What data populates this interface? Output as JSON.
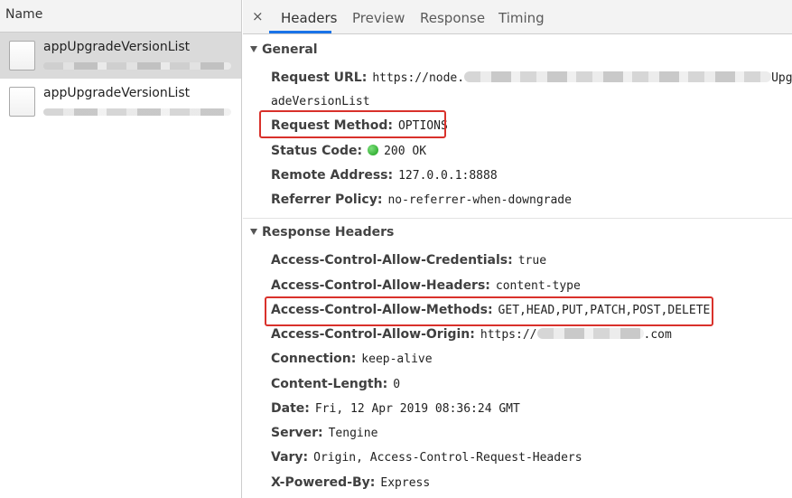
{
  "left_panel": {
    "header": "Name",
    "requests": [
      {
        "name": "appUpgradeVersionList",
        "selected": true
      },
      {
        "name": "appUpgradeVersionList",
        "selected": false
      }
    ]
  },
  "tabs": {
    "close_glyph": "×",
    "items": [
      "Headers",
      "Preview",
      "Response",
      "Timing"
    ],
    "active": "Headers"
  },
  "general": {
    "title": "General",
    "request_url_key": "Request URL:",
    "request_url_value_start": "https://node.",
    "request_url_value_end": "Upg",
    "request_url_wrap": "adeVersionList",
    "request_method_key": "Request Method:",
    "request_method_value": "OPTIONS",
    "status_code_key": "Status Code:",
    "status_code_value": "200 OK",
    "remote_address_key": "Remote Address:",
    "remote_address_value": "127.0.0.1:8888",
    "referrer_policy_key": "Referrer Policy:",
    "referrer_policy_value": "no-referrer-when-downgrade"
  },
  "response_headers": {
    "title": "Response Headers",
    "items": [
      {
        "key": "Access-Control-Allow-Credentials:",
        "value": "true"
      },
      {
        "key": "Access-Control-Allow-Headers:",
        "value": "content-type"
      },
      {
        "key": "Access-Control-Allow-Methods:",
        "value": "GET,HEAD,PUT,PATCH,POST,DELETE"
      },
      {
        "key": "Access-Control-Allow-Origin:",
        "value_start": "https://",
        "value_end": ".com"
      },
      {
        "key": "Connection:",
        "value": "keep-alive"
      },
      {
        "key": "Content-Length:",
        "value": "0"
      },
      {
        "key": "Date:",
        "value": "Fri, 12 Apr 2019 08:36:24 GMT"
      },
      {
        "key": "Server:",
        "value": "Tengine"
      },
      {
        "key": "Vary:",
        "value": "Origin, Access-Control-Request-Headers"
      },
      {
        "key": "X-Powered-By:",
        "value": "Express"
      }
    ]
  },
  "colors": {
    "highlight_box": "#d9312b",
    "active_tab_underline": "#1a73e8",
    "status_ok": "#1a9e1a"
  }
}
